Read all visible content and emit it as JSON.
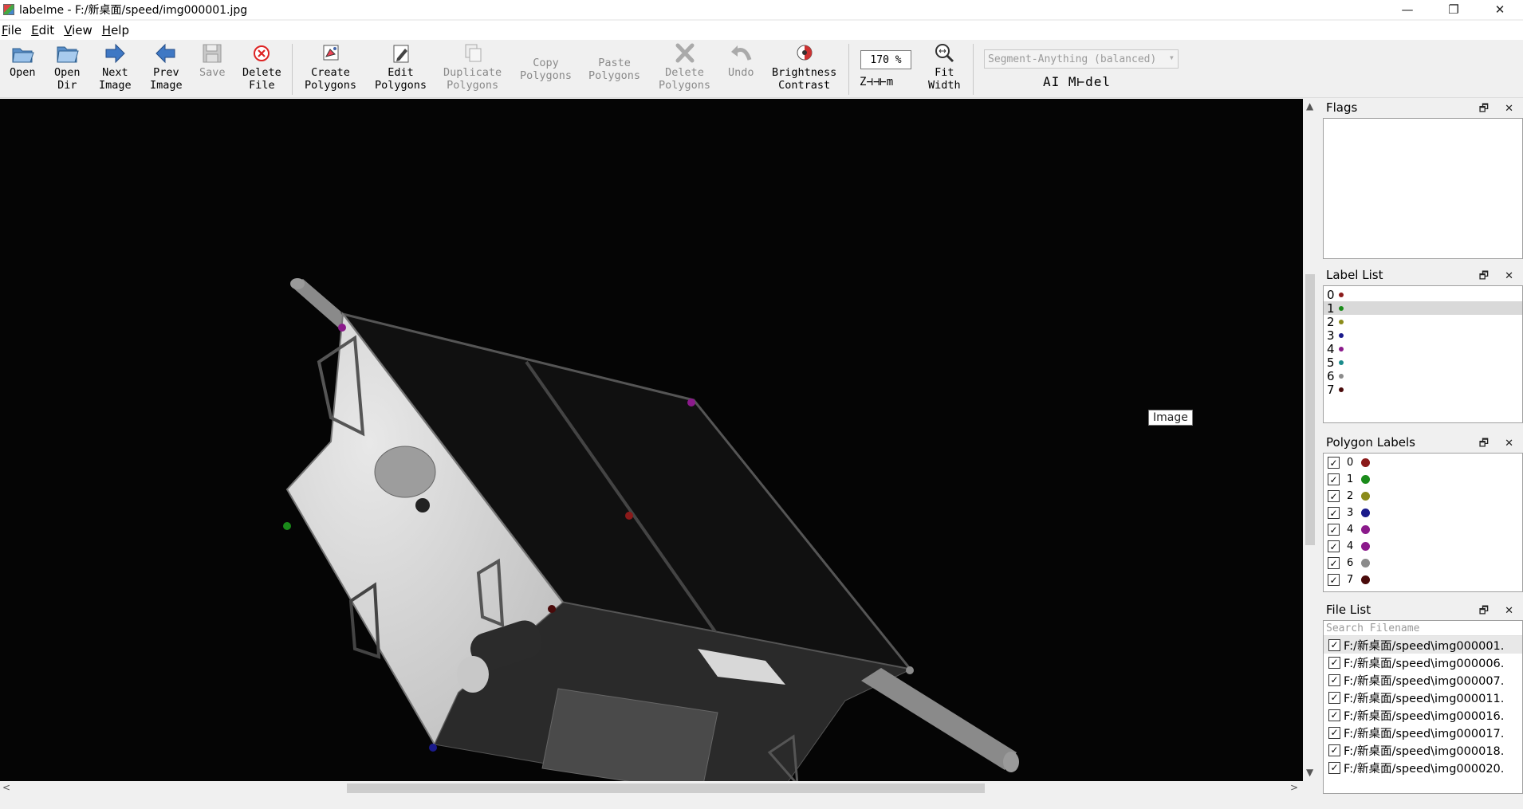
{
  "window": {
    "title": "labelme - F:/新桌面/speed/img000001.jpg",
    "controls": [
      "—",
      "❐",
      "✕"
    ]
  },
  "menu": [
    "File",
    "Edit",
    "View",
    "Help"
  ],
  "toolbar": {
    "open": "Open",
    "open_dir": [
      "Open",
      "Dir"
    ],
    "next_image": [
      "Next",
      "Image"
    ],
    "prev_image": [
      "Prev",
      "Image"
    ],
    "save": "Save",
    "delete_file": [
      "Delete",
      "File"
    ],
    "create_polygons": [
      "Create",
      "Polygons"
    ],
    "edit_polygons": [
      "Edit",
      "Polygons"
    ],
    "duplicate_polygons": [
      "Duplicate",
      "Polygons"
    ],
    "copy_polygons": [
      "Copy",
      "Polygons"
    ],
    "paste_polygons": [
      "Paste",
      "Polygons"
    ],
    "delete_polygons": [
      "Delete",
      "Polygons"
    ],
    "undo": "Undo",
    "brightness_contrast": [
      "Brightness",
      "Contrast"
    ],
    "zoom_value": "170 %",
    "zoom_label": "Z⊣⊣⊢m",
    "fit_width": [
      "Fit",
      "Width"
    ],
    "ai_model_value": "Segment-Anything (balanced)",
    "ai_model_label": "AI M⊢del"
  },
  "canvas": {
    "tooltip": "Image"
  },
  "flags_panel": {
    "title": "Flags"
  },
  "label_list": {
    "title": "Label List",
    "items": [
      {
        "label": "0",
        "color": "#8b1a1a"
      },
      {
        "label": "1",
        "color": "#1a8b1a"
      },
      {
        "label": "2",
        "color": "#8b8b1a"
      },
      {
        "label": "3",
        "color": "#1a1a8b"
      },
      {
        "label": "4",
        "color": "#8b1a8b"
      },
      {
        "label": "5",
        "color": "#1a8b8b"
      },
      {
        "label": "6",
        "color": "#8b8b8b"
      },
      {
        "label": "7",
        "color": "#4a0a0a"
      }
    ],
    "selected_index": 1
  },
  "polygon_labels": {
    "title": "Polygon Labels",
    "items": [
      {
        "label": "0",
        "color": "#8b1a1a",
        "checked": true
      },
      {
        "label": "1",
        "color": "#1a8b1a",
        "checked": true
      },
      {
        "label": "2",
        "color": "#8b8b1a",
        "checked": true
      },
      {
        "label": "3",
        "color": "#1a1a8b",
        "checked": true
      },
      {
        "label": "4",
        "color": "#8b1a8b",
        "checked": true
      },
      {
        "label": "4",
        "color": "#8b1a8b",
        "checked": true
      },
      {
        "label": "6",
        "color": "#8b8b8b",
        "checked": true
      },
      {
        "label": "7",
        "color": "#4a0a0a",
        "checked": true
      }
    ]
  },
  "file_list": {
    "title": "File List",
    "search_placeholder": "Search Filename",
    "items": [
      "F:/新桌面/speed\\img000001.",
      "F:/新桌面/speed\\img000006.",
      "F:/新桌面/speed\\img000007.",
      "F:/新桌面/speed\\img000011.",
      "F:/新桌面/speed\\img000016.",
      "F:/新桌面/speed\\img000017.",
      "F:/新桌面/speed\\img000018.",
      "F:/新桌面/speed\\img000020."
    ]
  },
  "scroll_arrows": {
    "up": "▲",
    "down": "▼",
    "left": "<",
    "right": ">"
  },
  "dock_buttons": "🗗 ✕",
  "keypoint_colors": [
    "#8b1a1a",
    "#1a8b1a",
    "#8b8b1a",
    "#1a1a8b",
    "#8b1a8b",
    "#8b1a8b",
    "#8b8b8b",
    "#4a0a0a"
  ]
}
